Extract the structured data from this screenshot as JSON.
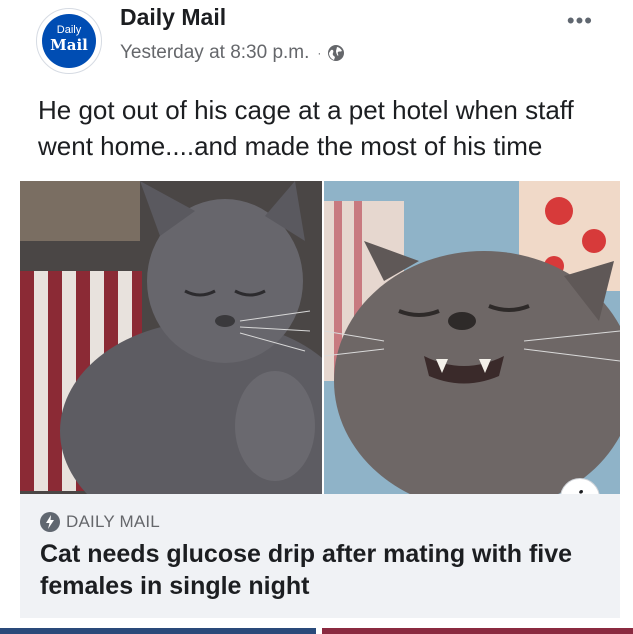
{
  "header": {
    "avatar": {
      "line1": "Daily",
      "line2": "Mail"
    },
    "page_name": "Daily Mail",
    "timestamp": "Yesterday at 8:30 p.m.",
    "separator": "·",
    "privacy_icon": "globe-icon",
    "more_label": "•••"
  },
  "post": {
    "caption": "He got out of his cage at a pet hotel when staff went home....and made the most of his time"
  },
  "photos": {
    "info_label": "i"
  },
  "link_preview": {
    "source": "DAILY MAIL",
    "source_icon": "lightning-icon",
    "headline": "Cat needs glucose drip after mating with five females in single night"
  },
  "colors": {
    "brand": "#004db3",
    "link_box_bg": "#f0f2f5",
    "secondary_text": "#65676b"
  }
}
